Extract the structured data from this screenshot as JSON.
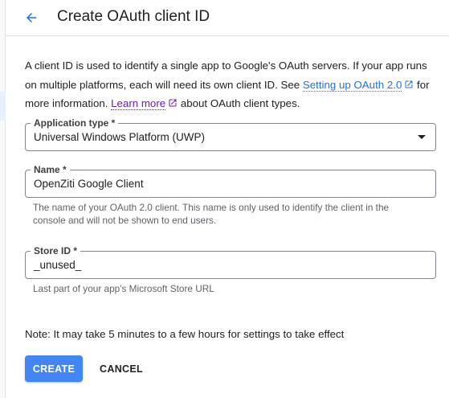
{
  "header": {
    "back_icon": "arrow-back-icon",
    "title": "Create OAuth client ID"
  },
  "intro": {
    "part1": "A client ID is used to identify a single app to Google's OAuth servers. If your app runs on multiple platforms, each will need its own client ID. See ",
    "link1": "Setting up OAuth 2.0",
    "part2": " for more information. ",
    "link2": "Learn more",
    "part3": " about OAuth client types.",
    "external_icon": "open-in-new-icon"
  },
  "fields": {
    "application_type": {
      "label": "Application type *",
      "value": "Universal Windows Platform (UWP)",
      "icon": "dropdown-arrow-icon"
    },
    "name": {
      "label": "Name *",
      "value": "OpenZiti Google Client",
      "hint": "The name of your OAuth 2.0 client. This name is only used to identify the client in the console and will not be shown to end users."
    },
    "store_id": {
      "label": "Store ID *",
      "value": "_unused_",
      "hint": "Last part of your app's Microsoft Store URL"
    }
  },
  "note": "Note: It may take 5 minutes to a few hours for settings to take effect",
  "actions": {
    "create_label": "CREATE",
    "cancel_label": "CANCEL"
  },
  "colors": {
    "primary": "#4285f4",
    "link": "#1a73e8",
    "visited_link": "#681da8",
    "border": "#80868b",
    "hint_text": "#5f6368"
  }
}
